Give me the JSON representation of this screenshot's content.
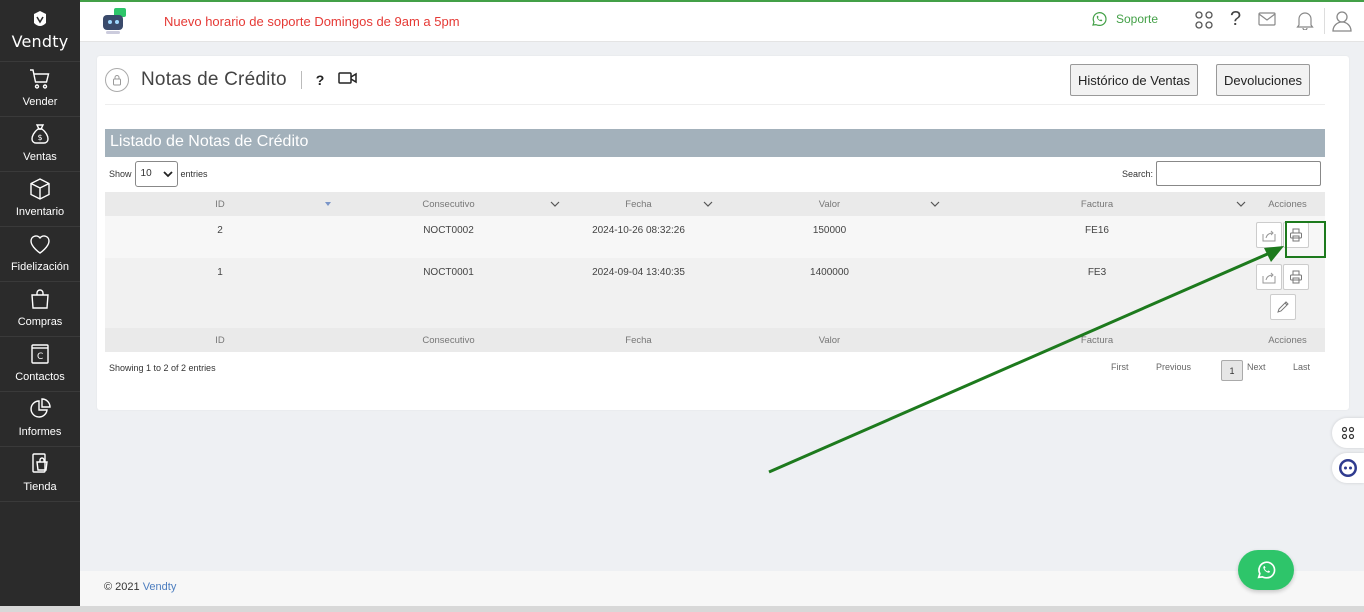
{
  "brand": "Vendty",
  "sidebar": {
    "items": [
      {
        "label": "Vender",
        "icon": "cart-icon"
      },
      {
        "label": "Ventas",
        "icon": "money-bag-icon"
      },
      {
        "label": "Inventario",
        "icon": "box-icon"
      },
      {
        "label": "Fidelización",
        "icon": "heart-icon"
      },
      {
        "label": "Compras",
        "icon": "shopping-bag-icon"
      },
      {
        "label": "Contactos",
        "icon": "contacts-book-icon"
      },
      {
        "label": "Informes",
        "icon": "pie-chart-icon"
      },
      {
        "label": "Tienda",
        "icon": "store-device-icon"
      }
    ]
  },
  "topbar": {
    "announcement": "Nuevo horario de soporte Domingos de 9am a 5pm",
    "support_label": "Soporte"
  },
  "page": {
    "title": "Notas de Crédito",
    "help": "?",
    "btn_historico": "Histórico de Ventas",
    "btn_devoluciones": "Devoluciones",
    "list_title": "Listado de Notas de Crédito"
  },
  "table": {
    "show_label": "Show",
    "entries_label": "entries",
    "page_size": "10",
    "search_label": "Search:",
    "columns": [
      "ID",
      "Consecutivo",
      "Fecha",
      "Valor",
      "Factura",
      "Acciones"
    ],
    "rows": [
      {
        "id": "2",
        "consecutivo": "NOCT0002",
        "fecha": "2024-10-26 08:32:26",
        "valor": "150000",
        "factura": "FE16"
      },
      {
        "id": "1",
        "consecutivo": "NOCT0001",
        "fecha": "2024-09-04 13:40:35",
        "valor": "1400000",
        "factura": "FE3"
      }
    ],
    "showing": "Showing 1 to 2 of 2 entries",
    "pager": {
      "first": "First",
      "previous": "Previous",
      "current": "1",
      "next": "Next",
      "last": "Last"
    }
  },
  "footer": {
    "copyright": "© 2021",
    "brand": "Vendty"
  },
  "colors": {
    "sidebar": "#2b2b2b",
    "accent_green": "#43a047",
    "announce_red": "#e53935",
    "list_header": "#a3b1bb",
    "highlight": "#1d7a1d"
  }
}
